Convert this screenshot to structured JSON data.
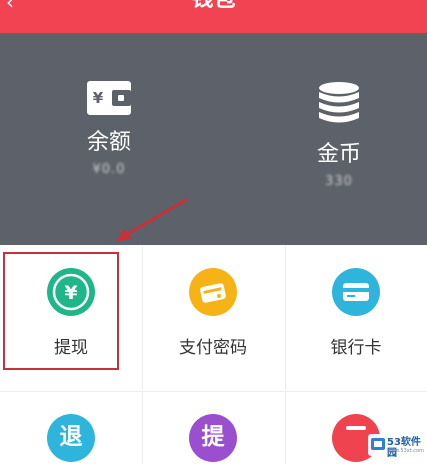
{
  "header": {
    "title": "钱包",
    "back_icon": "chevron-left-icon",
    "background_color": "#f24352"
  },
  "balance": {
    "background_color": "#5d6169",
    "items": [
      {
        "label": "余额",
        "value": "¥0.0",
        "icon": "wallet-yen-icon"
      },
      {
        "label": "金币",
        "value": "330",
        "icon": "coin-stack-icon"
      }
    ]
  },
  "grid": {
    "items": [
      {
        "label": "提现",
        "icon": "withdraw-yen-icon",
        "color": "#1fb68a"
      },
      {
        "label": "支付密码",
        "icon": "payment-password-icon",
        "color": "#f5b318"
      },
      {
        "label": "银行卡",
        "icon": "bank-card-icon",
        "color": "#2fb4dc"
      },
      {
        "label": "",
        "icon": "refund-icon",
        "glyph": "退",
        "color": "#2fb4dc"
      },
      {
        "label": "",
        "icon": "withdraw-record-icon",
        "glyph": "提",
        "color": "#9a4fcf"
      },
      {
        "label": "",
        "icon": "partial-red-icon",
        "color": "#ef4350"
      }
    ]
  },
  "annotation": {
    "highlight_color": "#c8313a"
  },
  "watermark": {
    "logo_icon": "watermark-logo-icon",
    "text": "53软件园",
    "sub": "www.53xt.com"
  }
}
